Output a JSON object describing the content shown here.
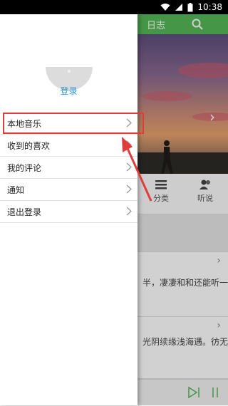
{
  "status_bar": {
    "time": "10:38"
  },
  "background_app": {
    "header_title": "日志",
    "tabs": [
      {
        "label": "分类",
        "icon": "list-icon"
      },
      {
        "label": "听说",
        "icon": "people-icon"
      }
    ],
    "cards": [
      {
        "text_line1": "",
        "text_line2": "半，凄凄和和还能听一"
      },
      {
        "text_line1": "",
        "text_line2": "光阴续缘浅海遇。彷无"
      }
    ],
    "player": {
      "play_icon": "play-next-icon",
      "pause_icon": "pause-icon"
    }
  },
  "drawer": {
    "login_label": "登录",
    "menu_items": [
      {
        "label": "本地音乐"
      },
      {
        "label": "收到的喜欢"
      },
      {
        "label": "我的评论"
      },
      {
        "label": "通知"
      },
      {
        "label": "退出登录"
      }
    ]
  },
  "colors": {
    "header_green": "#55b856",
    "highlight_red": "#e23b3b",
    "login_blue": "#2f8fd6"
  }
}
